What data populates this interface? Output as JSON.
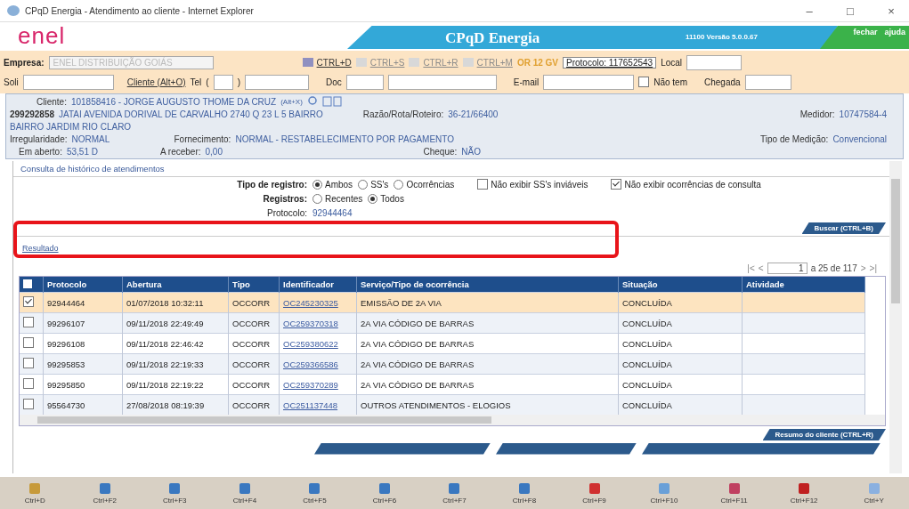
{
  "window": {
    "title": "CPqD Energia - Atendimento ao cliente - Internet Explorer",
    "controls": [
      "–",
      "□",
      "×"
    ]
  },
  "header": {
    "logo": "enel",
    "app_title": "CPqD Energia",
    "version": "11100 Versão 5.0.0.67",
    "links": [
      "fechar",
      "ajuda"
    ]
  },
  "toolbar": {
    "empresa_label": "Empresa:",
    "empresa_value": "ENEL DISTRIBUIÇÃO GOIÁS",
    "shortcuts": [
      {
        "label": "CTRL+D",
        "disabled": false
      },
      {
        "label": "CTRL+S",
        "disabled": true
      },
      {
        "label": "CTRL+R",
        "disabled": true
      },
      {
        "label": "CTRL+M",
        "disabled": true
      }
    ],
    "alert": "OR 12 GV",
    "protocolo": "Protocolo: 117652543",
    "local_label": "Local"
  },
  "fields": {
    "soli_label": "Soli",
    "cliente_link": "Cliente (Alt+O)",
    "tel_label": "Tel",
    "tel_open": "(",
    "tel_close": ")",
    "doc_label": "Doc",
    "email_label": "E-mail",
    "nao_tem": {
      "label": "Não tem",
      "checked": false
    },
    "chegada_label": "Chegada"
  },
  "client": {
    "cliente_label": "Cliente:",
    "cliente_value": "101858416 - JORGE AUGUSTO THOME DA CRUZ",
    "search_hint": "(Alt+X)",
    "uc": "299292858",
    "address": "JATAI AVENIDA DORIVAL DE CARVALHO 2740 Q 23 L 5 BAIRRO",
    "address_2": "BAIRRO JARDIM RIO CLARO",
    "razao_label": "Razão/Rota/Roteiro:",
    "razao_value": "36-21/66400",
    "medidor_label": "Medidor:",
    "medidor_value": "10747584-4",
    "irreg_label": "Irregularidade:",
    "irreg_value": "NORMAL",
    "fornec_label": "Fornecimento:",
    "fornec_value": "NORMAL - RESTABELECIMENTO POR PAGAMENTO",
    "tipo_med_label": "Tipo de Medição:",
    "tipo_med_value": "Convencional",
    "aberto_label": "Em aberto:",
    "aberto_value": "53,51 D",
    "receber_label": "A receber:",
    "receber_value": "0,00",
    "cheque_label": "Cheque:",
    "cheque_value": "NÃO"
  },
  "section_title": "Consulta de histórico de atendimentos",
  "filters": {
    "tipo_label": "Tipo de registro:",
    "tipo_options": [
      {
        "label": "Ambos",
        "selected": true
      },
      {
        "label": "SS's",
        "selected": false
      },
      {
        "label": "Ocorrências",
        "selected": false
      }
    ],
    "checks": [
      {
        "label": "Não exibir SS's inviáveis",
        "checked": false
      },
      {
        "label": "Não exibir ocorrências de consulta",
        "checked": true
      }
    ],
    "registros_label": "Registros:",
    "registros_options": [
      {
        "label": "Recentes",
        "selected": false
      },
      {
        "label": "Todos",
        "selected": true
      }
    ],
    "protocolo_label": "Protocolo:",
    "protocolo_value": "92944464"
  },
  "buscar": "Buscar (CTRL+B)",
  "resultado": "Resultado",
  "pagination": {
    "first": "|<",
    "prev": "<",
    "page": "1",
    "range": "a 25 de 117",
    "next": ">",
    "last": ">|"
  },
  "table": {
    "select_all_checked": false,
    "columns": [
      "Protocolo",
      "Abertura",
      "Tipo",
      "Identificador",
      "Serviço/Tipo de ocorrência",
      "Situação",
      "Atividade"
    ],
    "rows": [
      {
        "checked": true,
        "selected": true,
        "cells": [
          "92944464",
          "01/07/2018 10:32:11",
          "OCCORR",
          "OC245230325",
          "EMISSÃO DE 2A VIA",
          "CONCLUÍDA",
          ""
        ]
      },
      {
        "checked": false,
        "selected": false,
        "cells": [
          "99296107",
          "09/11/2018 22:49:49",
          "OCCORR",
          "OC259370318",
          "2A VIA CÓDIGO DE BARRAS",
          "CONCLUÍDA",
          ""
        ]
      },
      {
        "checked": false,
        "selected": false,
        "cells": [
          "99296108",
          "09/11/2018 22:46:42",
          "OCCORR",
          "OC259380622",
          "2A VIA CÓDIGO DE BARRAS",
          "CONCLUÍDA",
          ""
        ]
      },
      {
        "checked": false,
        "selected": false,
        "cells": [
          "99295853",
          "09/11/2018 22:19:33",
          "OCCORR",
          "OC259366586",
          "2A VIA CÓDIGO DE BARRAS",
          "CONCLUÍDA",
          ""
        ]
      },
      {
        "checked": false,
        "selected": false,
        "cells": [
          "99295850",
          "09/11/2018 22:19:22",
          "OCCORR",
          "OC259370289",
          "2A VIA CÓDIGO DE BARRAS",
          "CONCLUÍDA",
          ""
        ]
      },
      {
        "checked": false,
        "selected": false,
        "cells": [
          "95564730",
          "27/08/2018 08:19:39",
          "OCCORR",
          "OC251137448",
          "OUTROS ATENDIMENTOS - ELOGIOS",
          "CONCLUÍDA",
          ""
        ]
      }
    ]
  },
  "resumo": "Resumo do cliente (CTRL+R)",
  "footer_keys": [
    "Ctrl+D",
    "Ctrl+F2",
    "Ctrl+F3",
    "Ctrl+F4",
    "Ctrl+F5",
    "Ctrl+F6",
    "Ctrl+F7",
    "Ctrl+F8",
    "Ctrl+F9",
    "Ctrl+F10",
    "Ctrl+F11",
    "Ctrl+F12",
    "Ctrl+Y"
  ]
}
